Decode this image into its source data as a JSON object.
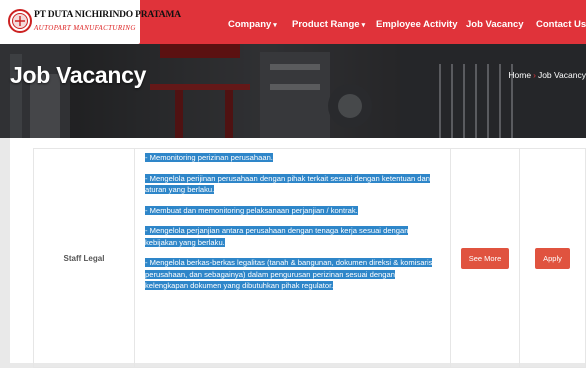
{
  "brand": {
    "name": "PT DUTA NICHIRINDO PRATAMA",
    "tagline": "AUTOPART MANUFACTURING"
  },
  "nav": {
    "items": [
      {
        "label": "Company",
        "dropdown": true
      },
      {
        "label": "Product Range",
        "dropdown": true
      },
      {
        "label": "Employee Activity",
        "dropdown": false
      },
      {
        "label": "Job Vacancy",
        "dropdown": false
      },
      {
        "label": "Contact Us",
        "dropdown": false
      }
    ]
  },
  "hero": {
    "title": "Job Vacancy",
    "breadcrumb": {
      "home": "Home",
      "separator": "›",
      "current": "Job Vacancy"
    }
  },
  "jobs": [
    {
      "title": "Staff Legal",
      "description": [
        "- Memonitoring perizinan perusahaan.",
        "- Mengelola perijinan perusahaan dengan pihak terkait sesuai dengan ketentuan dan aturan yang berlaku.",
        "- Membuat dan memonitoring pelaksanaan perjanjian / kontrak.",
        "- Mengelola perjanjian antara perusahaan dengan tenaga kerja sesuai dengan kebijakan yang berlaku.",
        "- Mengelola berkas-berkas legalitas (tanah & bangunan, dokumen direksi & komisaris perusahaan, dan sebagainya) dalam pengurusan perizinan sesuai dengan kelengkapan dokumen yang dibutuhkan pihak regulator."
      ],
      "see_more_label": "See More",
      "apply_label": "Apply"
    }
  ],
  "colors": {
    "brand_red": "#e0333a",
    "button_red": "#e0533f",
    "selection_blue": "#2e86c9"
  }
}
